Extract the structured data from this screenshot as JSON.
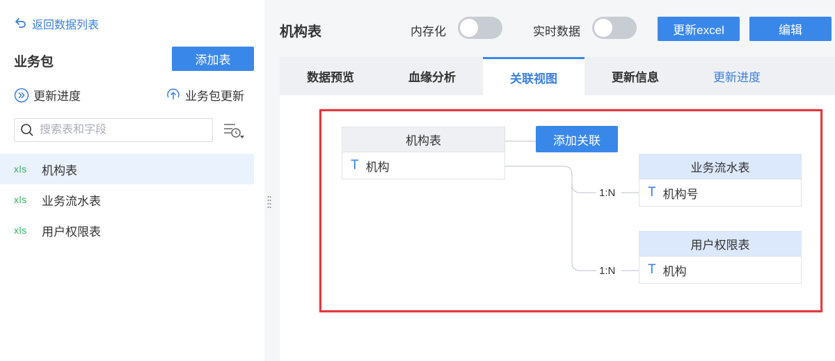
{
  "sidebar": {
    "back_label": "返回数据列表",
    "package_title": "业务包",
    "add_table_label": "添加表",
    "update_progress_label": "更新进度",
    "package_update_label": "业务包更新",
    "search_placeholder": "搜索表和字段",
    "tables": [
      {
        "icon": "xls",
        "name": "机构表",
        "active": true
      },
      {
        "icon": "xls",
        "name": "业务流水表",
        "active": false
      },
      {
        "icon": "xls",
        "name": "用户权限表",
        "active": false
      }
    ]
  },
  "header": {
    "title": "机构表",
    "in_memory_label": "内存化",
    "in_memory_on": false,
    "realtime_label": "实时数据",
    "realtime_on": false,
    "update_excel_label": "更新excel",
    "edit_label": "编辑"
  },
  "tabs": [
    {
      "label": "数据预览",
      "active": false
    },
    {
      "label": "血缘分析",
      "active": false
    },
    {
      "label": "关联视图",
      "active": true
    },
    {
      "label": "更新信息",
      "active": false
    },
    {
      "label": "更新进度",
      "active": false,
      "link": true
    }
  ],
  "relation_view": {
    "add_relation_label": "添加关联",
    "main_table": {
      "name": "机构表",
      "field": "机构",
      "field_type": "T"
    },
    "related_tables": [
      {
        "name": "业务流水表",
        "field": "机构号",
        "field_type": "T",
        "relation": "1:N"
      },
      {
        "name": "用户权限表",
        "field": "机构",
        "field_type": "T",
        "relation": "1:N"
      }
    ]
  },
  "colors": {
    "accent": "#3a87ea",
    "link": "#3a7fe0",
    "highlight": "#e0393e",
    "xls": "#2fb35a"
  }
}
